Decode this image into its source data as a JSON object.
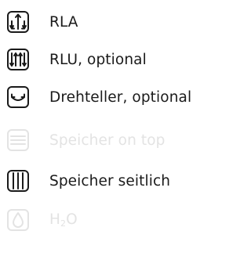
{
  "features": [
    {
      "label": "RLA",
      "icon": "rla-arrows-icon",
      "enabled": true
    },
    {
      "label": "RLU, optional",
      "icon": "rlu-arrows-icon",
      "enabled": true
    },
    {
      "label": "Drehteller, optional",
      "icon": "turntable-icon",
      "enabled": true
    },
    {
      "label": "Speicher on top",
      "icon": "storage-top-icon",
      "enabled": false
    },
    {
      "label": "Speicher seitlich",
      "icon": "storage-side-icon",
      "enabled": true
    },
    {
      "label_main": "H",
      "label_sub": "2",
      "label_end": "O",
      "icon": "water-drop-icon",
      "enabled": false
    }
  ],
  "colors": {
    "enabled": "#1a1a1a",
    "disabled": "#e3e3e3"
  }
}
